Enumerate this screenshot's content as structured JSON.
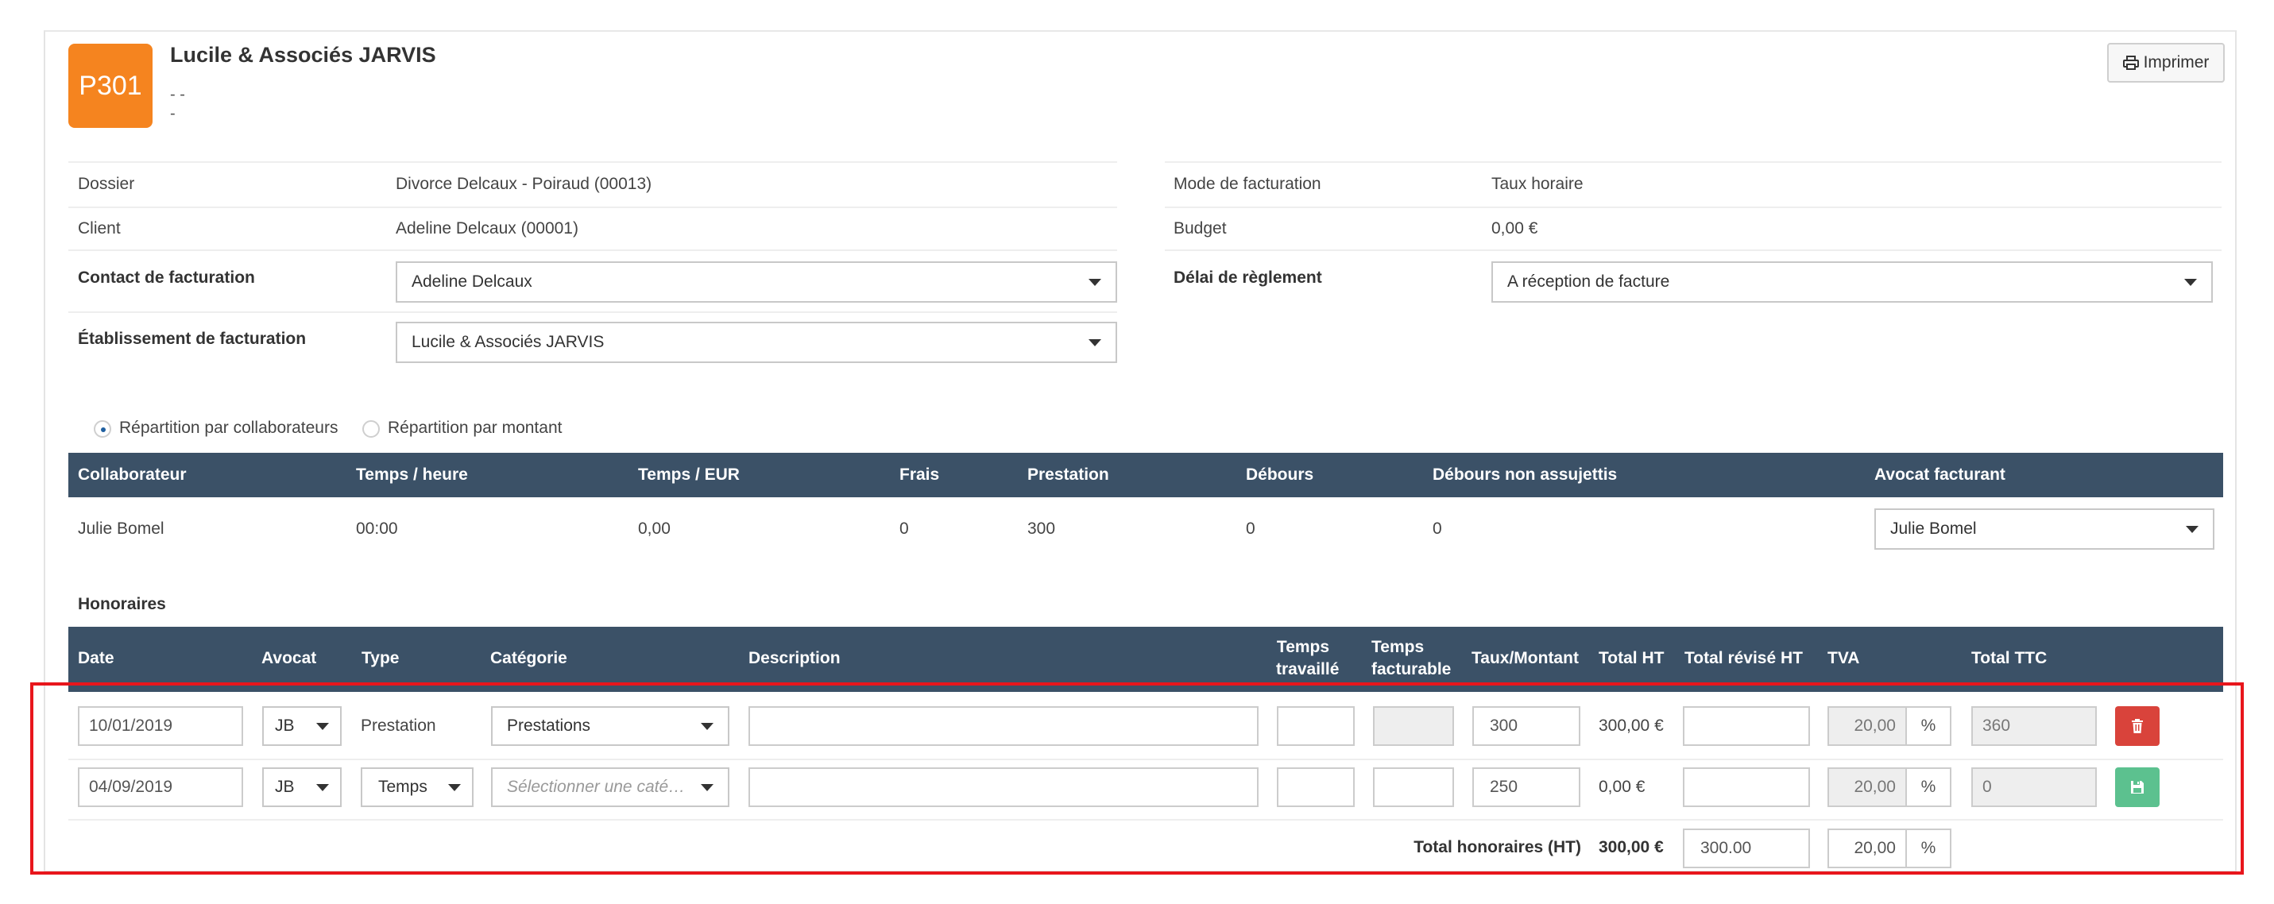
{
  "header": {
    "avatar_text": "P301",
    "title": "Lucile & Associés JARVIS",
    "line1": "- -",
    "line2": "-",
    "print_label": "Imprimer"
  },
  "info": {
    "dossier_label": "Dossier",
    "dossier_value": "Divorce Delcaux - Poiraud (00013)",
    "client_label": "Client",
    "client_value": "Adeline Delcaux (00001)",
    "contact_label": "Contact de facturation",
    "contact_value": "Adeline Delcaux",
    "etab_label": "Établissement de facturation",
    "etab_value": "Lucile & Associés JARVIS",
    "mode_label": "Mode de facturation",
    "mode_value": "Taux horaire",
    "budget_label": "Budget",
    "budget_value": "0,00 €",
    "delai_label": "Délai de règlement",
    "delai_value": "A réception de facture"
  },
  "repartition": {
    "option1": "Répartition par collaborateurs",
    "option2": "Répartition par montant",
    "selected": "option1"
  },
  "collab_table": {
    "headers": [
      "Collaborateur",
      "Temps / heure",
      "Temps / EUR",
      "Frais",
      "Prestation",
      "Débours",
      "Débours non assujettis",
      "Avocat facturant"
    ],
    "row": {
      "collaborateur": "Julie Bomel",
      "temps_heure": "00:00",
      "temps_eur": "0,00",
      "frais": "0",
      "prestation": "300",
      "debours": "0",
      "debours_na": "0",
      "avocat": "Julie Bomel"
    }
  },
  "honoraires": {
    "section_title": "Honoraires",
    "headers": {
      "date": "Date",
      "avocat": "Avocat",
      "type": "Type",
      "categorie": "Catégorie",
      "description": "Description",
      "temps_travaille_1": "Temps",
      "temps_travaille_2": "travaillé",
      "temps_facturable_1": "Temps",
      "temps_facturable_2": "facturable",
      "taux": "Taux/Montant",
      "total_ht": "Total HT",
      "total_revise": "Total révisé HT",
      "tva": "TVA",
      "total_ttc": "Total TTC"
    },
    "rows": [
      {
        "date": "10/01/2019",
        "avocat": "JB",
        "type": "Prestation",
        "categorie": "Prestations",
        "description": "",
        "temps_travaille": "",
        "temps_facturable": "",
        "taux": "300",
        "total_ht": "300,00 €",
        "total_revise": "",
        "tva": "20,00",
        "pct": "%",
        "total_ttc": "360",
        "action": "delete"
      },
      {
        "date": "04/09/2019",
        "avocat": "JB",
        "type": "Temps",
        "categorie": "Sélectionner une caté…",
        "description": "",
        "temps_travaille": "",
        "temps_facturable": "",
        "taux": "250",
        "total_ht": "0,00 €",
        "total_revise": "",
        "tva": "20,00",
        "pct": "%",
        "total_ttc": "0",
        "action": "save"
      }
    ],
    "total_label": "Total honoraires (HT)",
    "total_value": "300,00 €",
    "total_revise": "300.00",
    "total_tva": "20,00",
    "total_pct": "%"
  },
  "colors": {
    "avatar": "#f5841f",
    "table_header": "#3b5167",
    "delete": "#d9433b",
    "save": "#5cc18f",
    "highlight": "#e8161c"
  }
}
